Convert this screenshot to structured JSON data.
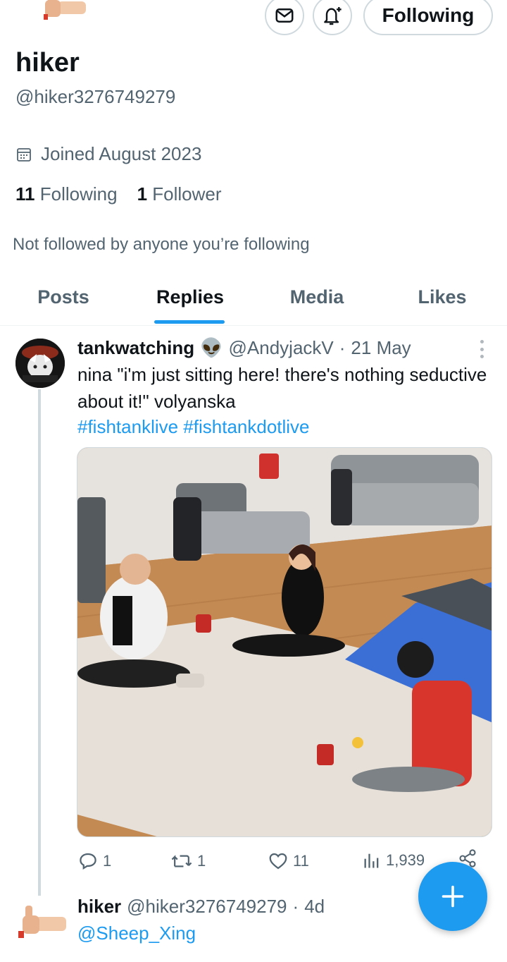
{
  "profile": {
    "display_name": "hiker",
    "handle": "@hiker3276749279",
    "joined": "Joined August 2023",
    "following_count": "11",
    "following_label": "Following",
    "followers_count": "1",
    "followers_label": "Follower",
    "not_followed_text": "Not followed by anyone you’re following",
    "follow_button_label": "Following",
    "icons": [
      "message-icon",
      "notification-bell-icon",
      "calendar-icon"
    ]
  },
  "tabs": [
    {
      "label": "Posts",
      "active": false
    },
    {
      "label": "Replies",
      "active": true
    },
    {
      "label": "Media",
      "active": false
    },
    {
      "label": "Likes",
      "active": false
    }
  ],
  "tweet": {
    "author_name": "tankwatching",
    "author_emoji": "👽",
    "author_handle": "@AndyjackV",
    "date": "21 May",
    "separator": "·",
    "text": "nina \"i'm just sitting here! there's nothing seductive about it!\" volyanska",
    "hashtags": "#fishtanklive #fishtankdotlive",
    "stats": {
      "replies": "1",
      "retweets": "1",
      "likes": "11",
      "views": "1,939"
    }
  },
  "reply": {
    "author_name": "hiker",
    "author_handle": "@hiker3276749279",
    "time": "4d",
    "separator": "·",
    "mention": "@Sheep_Xing"
  },
  "colors": {
    "accent": "#1d9bf0",
    "text_primary": "#0f1419",
    "text_secondary": "#536471",
    "border": "#cfd9de"
  }
}
